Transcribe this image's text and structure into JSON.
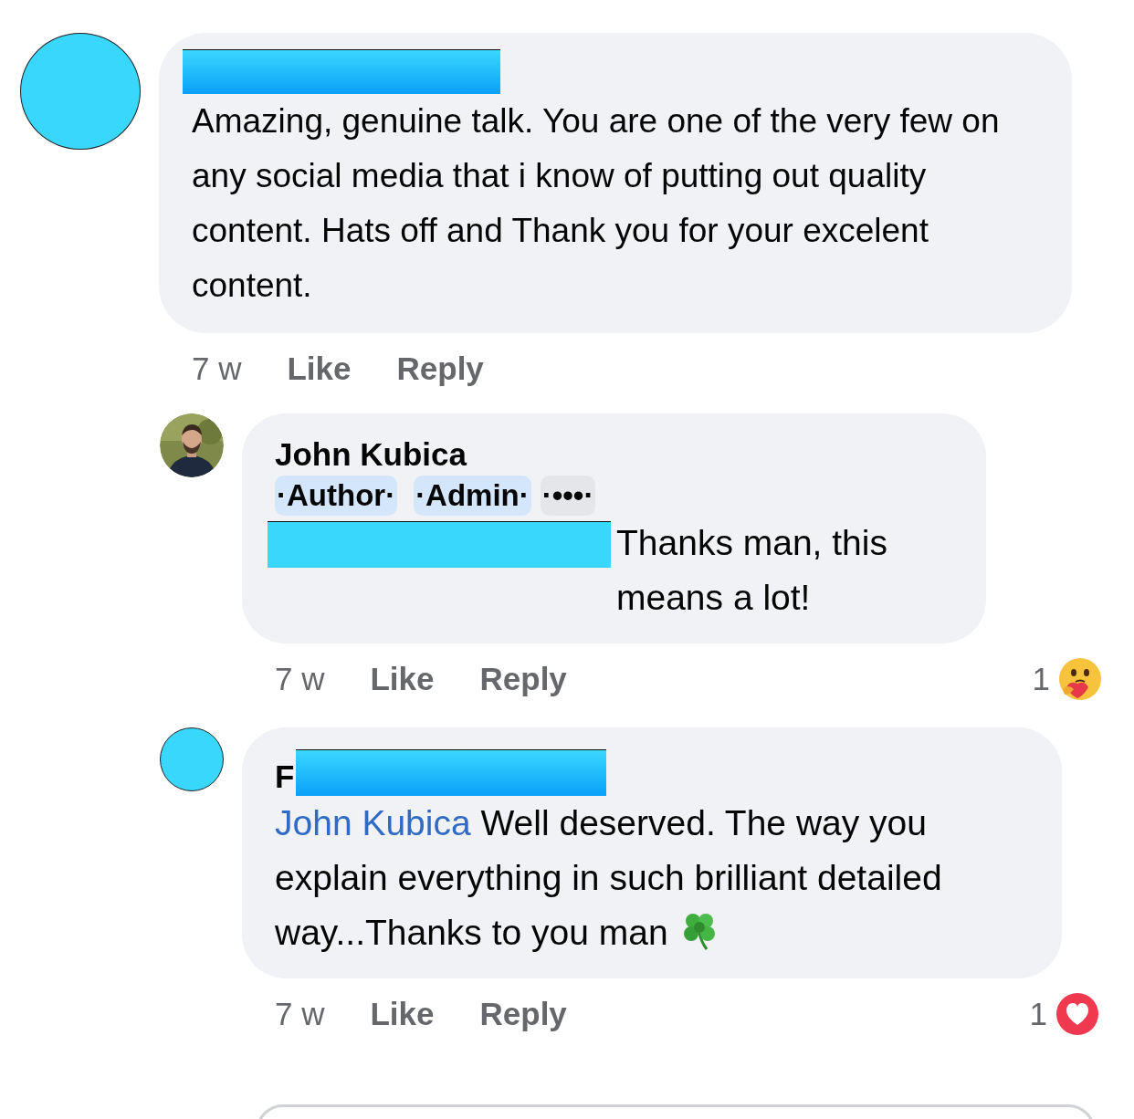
{
  "comments": [
    {
      "kind": "top",
      "avatar": {
        "kind": "redacted"
      },
      "author": {
        "kind": "redacted"
      },
      "body": {
        "kind": "plain",
        "text": "Amazing, genuine talk. You are one of the very few on any social media that i know of putting out quality content. Hats off and Thank you for your excelent content."
      },
      "time": "7 w",
      "actions": [
        "Like",
        "Reply"
      ]
    },
    {
      "kind": "reply",
      "avatar": {
        "kind": "picture"
      },
      "author": {
        "kind": "shown",
        "text": "John Kubica"
      },
      "badges": [
        {
          "label": "·Author·",
          "kind": "role"
        },
        {
          "label": "·Admin·",
          "kind": "role"
        },
        {
          "label": "·•••·",
          "kind": "more"
        }
      ],
      "body": {
        "kind": "redacted_prefix",
        "text": "Thanks man, this means a lot!"
      },
      "time": "7 w",
      "actions": [
        "Like",
        "Reply"
      ],
      "reaction": {
        "count": "1",
        "kind": "care"
      }
    },
    {
      "kind": "reply",
      "avatar": {
        "kind": "redacted"
      },
      "author": {
        "kind": "partly_redacted",
        "text": "F"
      },
      "body": {
        "kind": "mention_icon",
        "mention": "John Kubica",
        "text": "Well deserved. The way you explain everything in such brilliant detailed way...Thanks to you man"
      },
      "time": "7 w",
      "actions": [
        "Like",
        "Reply"
      ],
      "reaction": {
        "count": "1",
        "kind": "love"
      }
    }
  ]
}
